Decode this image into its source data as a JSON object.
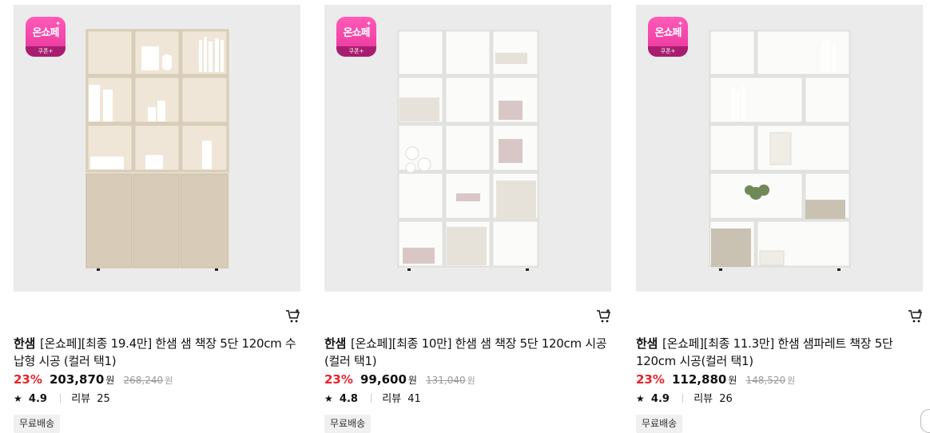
{
  "products": [
    {
      "brand": "한샘",
      "name": "[온쇼페][최종 19.4만] 한샘 샘 책장 5단 120cm 수납형 시공 (컬러 택1)",
      "discount": "23%",
      "price": "203,870",
      "price_unit": "원",
      "original_price": "268,240",
      "original_unit": "원",
      "star": "★",
      "rating": "4.9",
      "review_label": "리뷰",
      "review_count": "25",
      "shipping": "무료배송",
      "badge_logo": "온쇼페",
      "badge_sub": "쿠폰+",
      "cart_icon": "cart-add-icon"
    },
    {
      "brand": "한샘",
      "name": "[온쇼페][최종 10만] 한샘 샘 책장 5단 120cm 시공(컬러 택1)",
      "discount": "23%",
      "price": "99,600",
      "price_unit": "원",
      "original_price": "131,040",
      "original_unit": "원",
      "star": "★",
      "rating": "4.8",
      "review_label": "리뷰",
      "review_count": "41",
      "shipping": "무료배송",
      "badge_logo": "온쇼페",
      "badge_sub": "쿠폰+",
      "cart_icon": "cart-add-icon"
    },
    {
      "brand": "한샘",
      "name": "[온쇼페][최종 11.3만] 한샘 샘파레트 책장 5단 120cm 시공(컬러 택1)",
      "discount": "23%",
      "price": "112,880",
      "price_unit": "원",
      "original_price": "148,520",
      "original_unit": "원",
      "star": "★",
      "rating": "4.9",
      "review_label": "리뷰",
      "review_count": "26",
      "shipping": "무료배송",
      "badge_logo": "온쇼페",
      "badge_sub": "쿠폰+",
      "cart_icon": "cart-add-icon"
    }
  ],
  "colors": {
    "discount": "#e8232a",
    "badge": "#e8339b",
    "thumb_bg": "#ebebeb"
  }
}
